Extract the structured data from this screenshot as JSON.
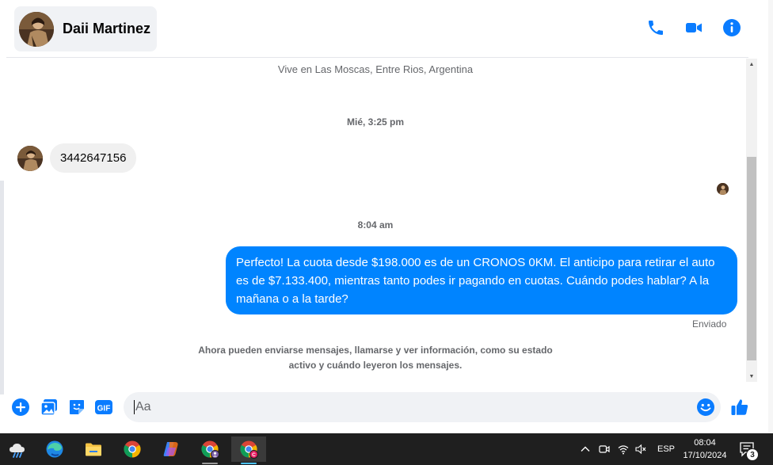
{
  "header": {
    "contact_name": "Daii Martinez",
    "icons": [
      "phone-icon",
      "video-camera-icon",
      "info-icon"
    ]
  },
  "conversation": {
    "location": "Vive en Las Moscas, Entre Rios, Argentina",
    "timestamp_1": "Mié, 3:25 pm",
    "incoming_message": "3442647156",
    "timestamp_2": "8:04 am",
    "outgoing_message": "Perfecto! La cuota desde $198.000 es de un CRONOS 0KM. El anticipo para retirar el auto es de $7.133.400, mientras tanto podes ir pagando en cuotas. Cuándo podes hablar? A la mañana o a la tarde?",
    "sent_status": "Enviado",
    "system_note": "Ahora pueden enviarse mensajes, llamarse y ver información, como su estado activo y cuándo leyeron los mensajes."
  },
  "composer": {
    "placeholder": "Aa",
    "icons": [
      "plus-icon",
      "image-icon",
      "sticker-icon",
      "gif-icon",
      "emoji-icon",
      "thumbs-up-icon"
    ]
  },
  "taskbar": {
    "apps": [
      "weather-icon",
      "edge-icon",
      "file-explorer-icon",
      "chrome-icon",
      "copilot-icon",
      "chrome-profile-icon",
      "chrome-active-icon"
    ],
    "language": "ESP",
    "time": "08:04",
    "date": "17/10/2024",
    "notification_count": "3"
  },
  "colors": {
    "accent": "#0084ff",
    "icon_blue": "#0a7cff",
    "incoming_bubble": "#f0f0f0",
    "muted_text": "#65676b",
    "taskbar": "#1f1f1f"
  }
}
